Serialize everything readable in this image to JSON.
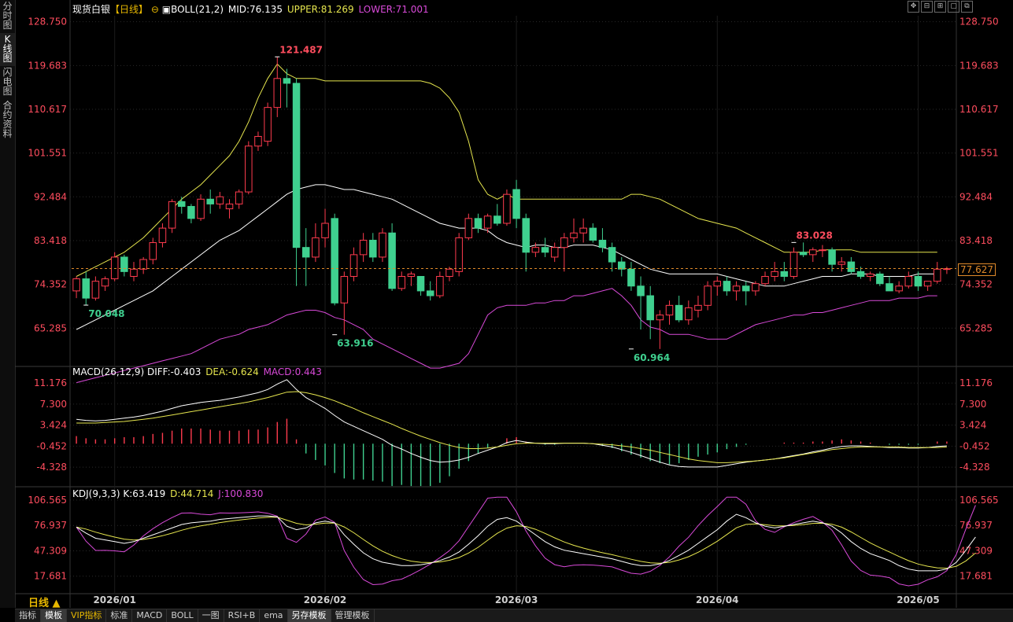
{
  "sidebar": {
    "items": [
      {
        "label": "分时图",
        "active": false
      },
      {
        "label": "K线图",
        "active": true
      },
      {
        "label": "闪电图",
        "active": false
      },
      {
        "label": "合约资料",
        "active": false
      }
    ]
  },
  "header": {
    "instrument": "现货白银",
    "period": "【日线】",
    "indicator": "BOLL(21,2)",
    "mid": "MID:76.135",
    "upper": "UPPER:81.269",
    "lower": "LOWER:71.001"
  },
  "macd_legend": {
    "name": "MACD(26,12,9)",
    "diff": "DIFF:-0.403",
    "dea": "DEA:-0.624",
    "macd": "MACD:0.443"
  },
  "kdj_legend": {
    "name": "KDJ(9,3,3)",
    "k": "K:63.419",
    "d": "D:44.714",
    "j": "J:100.830"
  },
  "toolbar_icons": [
    "move-cross-icon",
    "zoom-out-icon",
    "zoom-in-icon",
    "window-icon",
    "expand-icon"
  ],
  "current_price": "77.627",
  "period_selector": "日线 ▲",
  "bottom_tabs": [
    {
      "label": "指标",
      "active": false,
      "vip": false
    },
    {
      "label": "模板",
      "active": true,
      "vip": false
    },
    {
      "label": "VIP指标",
      "active": false,
      "vip": true
    },
    {
      "label": "标准",
      "active": false,
      "vip": false
    },
    {
      "label": "MACD",
      "active": false,
      "vip": false
    },
    {
      "label": "BOLL",
      "active": false,
      "vip": false
    },
    {
      "label": "一图",
      "active": false,
      "vip": false
    },
    {
      "label": "RSI+B",
      "active": false,
      "vip": false
    },
    {
      "label": "ema",
      "active": false,
      "vip": false
    },
    {
      "label": "另存模板",
      "active": true,
      "vip": false
    },
    {
      "label": "管理模板",
      "active": false,
      "vip": false
    }
  ],
  "colors": {
    "up": "#ff3b4e",
    "down": "#3fd08f",
    "upper": "#e6e64e",
    "mid": "#ffffff",
    "lower": "#d94ad9",
    "axis_label": "#ff4d5e",
    "grid": "#2a2a2a"
  },
  "chart_data": {
    "type": "candlestick",
    "price_axis": {
      "ticks": [
        "128.750",
        "119.683",
        "110.617",
        "101.551",
        "92.484",
        "83.418",
        "74.352",
        "65.285"
      ],
      "range": [
        58,
        130
      ]
    },
    "macd_axis": {
      "ticks": [
        "11.176",
        "7.300",
        "3.424",
        "-0.452",
        "-4.328"
      ],
      "range": [
        -7.5,
        12.5
      ]
    },
    "kdj_axis": {
      "ticks": [
        "106.565",
        "76.937",
        "47.309",
        "17.681"
      ],
      "range": [
        0,
        112
      ]
    },
    "x_labels": [
      {
        "text": "2026/01",
        "index": 4
      },
      {
        "text": "2026/02",
        "index": 26
      },
      {
        "text": "2026/03",
        "index": 46
      },
      {
        "text": "2026/04",
        "index": 67
      },
      {
        "text": "2026/05",
        "index": 88
      }
    ],
    "annotations": [
      {
        "text": "121.487",
        "index": 21,
        "value": 121.487,
        "kind": "high"
      },
      {
        "text": "70.048",
        "index": 1,
        "value": 70.048,
        "kind": "low"
      },
      {
        "text": "63.916",
        "index": 27,
        "value": 63.916,
        "kind": "low"
      },
      {
        "text": "60.964",
        "index": 58,
        "value": 60.964,
        "kind": "low"
      },
      {
        "text": "83.028",
        "index": 75,
        "value": 83.028,
        "kind": "high"
      }
    ],
    "ohlc": [
      [
        73,
        76,
        71.5,
        75.5
      ],
      [
        75.5,
        77,
        70,
        71.5
      ],
      [
        71.5,
        76,
        71,
        75
      ],
      [
        74,
        76,
        73,
        75.5
      ],
      [
        75.5,
        81,
        75,
        80
      ],
      [
        80,
        80.5,
        76,
        77
      ],
      [
        76,
        79,
        75,
        77.5
      ],
      [
        77.5,
        80,
        76.5,
        79.5
      ],
      [
        79.5,
        84,
        78.5,
        83
      ],
      [
        83,
        87,
        82,
        86
      ],
      [
        86,
        92,
        85,
        91.5
      ],
      [
        91.5,
        92.5,
        89,
        90.5
      ],
      [
        90.5,
        91,
        87,
        88
      ],
      [
        88,
        93,
        87.5,
        92
      ],
      [
        92,
        94,
        89,
        91
      ],
      [
        91,
        93.5,
        90,
        92.5
      ],
      [
        90,
        92,
        88,
        91
      ],
      [
        91,
        94,
        90,
        93.5
      ],
      [
        93.5,
        104,
        93,
        103
      ],
      [
        103,
        106,
        102,
        105
      ],
      [
        104,
        112,
        103,
        111
      ],
      [
        111,
        121.487,
        109,
        117
      ],
      [
        117,
        119,
        111,
        116
      ],
      [
        116,
        117,
        74,
        82
      ],
      [
        82,
        86,
        74,
        80
      ],
      [
        80,
        87,
        79,
        84
      ],
      [
        84,
        90,
        82,
        87
      ],
      [
        88,
        89,
        70,
        70.5
      ],
      [
        70.5,
        77,
        63.916,
        76
      ],
      [
        76,
        82,
        75,
        80.5
      ],
      [
        80.5,
        85,
        79,
        83.5
      ],
      [
        83.5,
        85,
        79,
        80
      ],
      [
        80,
        86,
        79,
        85
      ],
      [
        85,
        87,
        73,
        73.5
      ],
      [
        73.5,
        77,
        73,
        76
      ],
      [
        76,
        77,
        74,
        76.5
      ],
      [
        76,
        76,
        72,
        73
      ],
      [
        73,
        75,
        71,
        72
      ],
      [
        72,
        77,
        71.5,
        76
      ],
      [
        76,
        78,
        75,
        77.5
      ],
      [
        77,
        85,
        76,
        84
      ],
      [
        84,
        89,
        83.5,
        88
      ],
      [
        88,
        89,
        85,
        86
      ],
      [
        86,
        89,
        85,
        88.5
      ],
      [
        88.5,
        91,
        86.5,
        87
      ],
      [
        87,
        94,
        86.5,
        93
      ],
      [
        94,
        96,
        86,
        88
      ],
      [
        88,
        89,
        77,
        81
      ],
      [
        81,
        83,
        80,
        82
      ],
      [
        82,
        84,
        80,
        81
      ],
      [
        80,
        83,
        79,
        82
      ],
      [
        82,
        85,
        77,
        84
      ],
      [
        84,
        88,
        83,
        85
      ],
      [
        85,
        88,
        83,
        86
      ],
      [
        86,
        87,
        83,
        83.5
      ],
      [
        83.5,
        86,
        81,
        82
      ],
      [
        82,
        83,
        77,
        79
      ],
      [
        79,
        80,
        76,
        77.5
      ],
      [
        77.5,
        79,
        73,
        74
      ],
      [
        74,
        76,
        65,
        72
      ],
      [
        72,
        74,
        63,
        67
      ],
      [
        67,
        69,
        60.964,
        68
      ],
      [
        68,
        71,
        66,
        70
      ],
      [
        70,
        72,
        66.5,
        67
      ],
      [
        67,
        71,
        66,
        69.5
      ],
      [
        69,
        72,
        67.5,
        70
      ],
      [
        70,
        75,
        69,
        74
      ],
      [
        74,
        76,
        72,
        75
      ],
      [
        75,
        76,
        72,
        73
      ],
      [
        73,
        75,
        71,
        74
      ],
      [
        74,
        75,
        70,
        73
      ],
      [
        73,
        75,
        72,
        74.5
      ],
      [
        74.5,
        77,
        74,
        76
      ],
      [
        76,
        79,
        75,
        77
      ],
      [
        77,
        79,
        75,
        76
      ],
      [
        76,
        82,
        75.5,
        81
      ],
      [
        81,
        83.028,
        80,
        80.5
      ],
      [
        80.5,
        82,
        79,
        81.5
      ],
      [
        81.5,
        82.5,
        80,
        81.5
      ],
      [
        81.5,
        82,
        77,
        78.5
      ],
      [
        78.5,
        80,
        77,
        79
      ],
      [
        79,
        80,
        76.5,
        77
      ],
      [
        77,
        78,
        75.5,
        76
      ],
      [
        76,
        77,
        75,
        76.5
      ],
      [
        76.5,
        77,
        74,
        74.5
      ],
      [
        74.5,
        76,
        73,
        73
      ],
      [
        73,
        75,
        72.5,
        74
      ],
      [
        74,
        77,
        73.5,
        76
      ],
      [
        76,
        77,
        73,
        74
      ],
      [
        74,
        75,
        73,
        75
      ],
      [
        75,
        79,
        74.5,
        77.5
      ],
      [
        77.5,
        78,
        76.5,
        77.6
      ]
    ],
    "boll": {
      "mid": [
        65,
        66,
        67,
        68,
        69,
        70,
        71,
        72,
        73,
        74.5,
        76,
        77.5,
        79,
        80.5,
        82,
        83.5,
        84.5,
        85.5,
        87,
        88.5,
        90,
        91.5,
        93,
        94,
        94.5,
        95,
        95,
        94.5,
        94,
        94,
        93.5,
        93,
        92.5,
        92,
        91,
        90,
        89,
        88,
        87,
        86.5,
        86,
        86,
        86,
        85.5,
        84,
        83,
        82.5,
        82,
        82.5,
        82.5,
        82,
        82,
        82.5,
        82.5,
        82.5,
        82,
        81.5,
        80.5,
        79.5,
        78.5,
        77.5,
        77,
        76.5,
        76.5,
        76.5,
        76.5,
        76.5,
        76.5,
        76,
        75.5,
        75,
        74.5,
        74,
        74,
        74,
        74.5,
        75,
        75.5,
        76,
        76,
        76,
        76.5,
        76.5,
        76.5,
        76,
        76,
        76,
        76,
        76.5,
        76.5,
        76.5
      ],
      "upper": [
        76,
        77,
        78,
        79,
        80,
        81,
        82.5,
        84,
        86,
        88,
        90,
        92,
        93.5,
        95,
        97,
        99,
        101,
        104,
        108,
        113,
        117,
        120,
        118,
        117,
        117,
        117,
        116.5,
        116.5,
        116.5,
        116.5,
        116.5,
        116.5,
        116.5,
        116.5,
        116.5,
        116.5,
        116.5,
        116,
        115,
        113,
        110,
        104,
        96,
        93,
        92,
        93,
        92,
        92,
        92,
        92,
        92,
        92,
        92,
        92,
        92,
        92,
        92,
        92,
        93,
        93,
        92.5,
        92,
        91,
        90,
        89,
        88,
        87.5,
        87,
        86.5,
        86,
        85,
        84,
        83,
        82,
        81,
        81,
        81,
        81,
        81.5,
        81.5,
        81.5,
        81.5,
        81,
        81,
        81,
        81,
        81,
        81,
        81,
        81,
        81
      ],
      "lower": [
        54,
        54.5,
        55,
        55.5,
        56,
        56.5,
        57,
        57.5,
        58,
        58.5,
        59,
        59.5,
        60,
        61,
        62,
        63,
        63.5,
        64,
        65,
        65.5,
        66,
        67,
        68,
        68.5,
        69,
        69,
        68.5,
        67.5,
        67,
        66,
        65,
        63,
        62,
        61,
        60,
        59,
        58,
        57,
        57,
        57.5,
        58,
        60,
        64,
        68,
        69.5,
        70,
        70,
        70,
        70.5,
        70.5,
        71,
        71,
        72,
        72,
        72.5,
        73,
        73.5,
        72,
        70,
        67,
        65.5,
        65,
        64,
        64,
        64,
        63.5,
        63,
        63,
        63,
        64,
        65,
        66,
        66.5,
        67,
        67.5,
        68,
        68,
        68.5,
        68.5,
        69,
        69.5,
        70,
        70.5,
        71,
        71,
        71,
        71.5,
        71.5,
        71.5,
        72,
        72
      ]
    },
    "macd": {
      "diff": [
        4.5,
        4.3,
        4.2,
        4.3,
        4.5,
        4.7,
        4.9,
        5.2,
        5.6,
        6,
        6.5,
        7,
        7.3,
        7.6,
        7.8,
        8,
        8.3,
        8.6,
        9,
        9.4,
        10,
        11,
        11.8,
        10,
        8.5,
        7.5,
        6.5,
        5.2,
        4,
        3.2,
        2.4,
        1.6,
        0.8,
        -0.3,
        -1,
        -1.8,
        -2.5,
        -3.1,
        -3.4,
        -3.3,
        -3,
        -2.5,
        -1.8,
        -1.2,
        -0.6,
        0.2,
        0.6,
        0.3,
        0.1,
        0,
        0,
        0.1,
        0.1,
        0.1,
        0,
        -0.3,
        -0.6,
        -1.1,
        -1.6,
        -2.2,
        -2.8,
        -3.4,
        -3.9,
        -4.2,
        -4.3,
        -4.3,
        -4.3,
        -4.3,
        -4,
        -3.7,
        -3.4,
        -3.2,
        -3,
        -2.8,
        -2.5,
        -2.2,
        -1.9,
        -1.5,
        -1.2,
        -0.8,
        -0.5,
        -0.4,
        -0.4,
        -0.5,
        -0.6,
        -0.7,
        -0.7,
        -0.8,
        -0.8,
        -0.7,
        -0.5,
        -0.4
      ],
      "dea": [
        3.8,
        3.8,
        3.8,
        3.9,
        4,
        4.1,
        4.3,
        4.5,
        4.7,
        5,
        5.3,
        5.6,
        5.9,
        6.2,
        6.5,
        6.8,
        7.1,
        7.4,
        7.7,
        8.1,
        8.5,
        9,
        9.5,
        9.6,
        9.4,
        9,
        8.5,
        7.9,
        7.2,
        6.5,
        5.7,
        5,
        4.3,
        3.6,
        2.8,
        2.1,
        1.4,
        0.8,
        0.2,
        -0.3,
        -0.7,
        -0.9,
        -0.9,
        -0.8,
        -0.6,
        -0.3,
        0,
        0.1,
        0.1,
        0.1,
        0.1,
        0.1,
        0.1,
        0.1,
        0,
        -0.1,
        -0.2,
        -0.4,
        -0.6,
        -0.9,
        -1.2,
        -1.6,
        -2,
        -2.4,
        -2.8,
        -3.1,
        -3.3,
        -3.5,
        -3.5,
        -3.4,
        -3.3,
        -3.2,
        -3,
        -2.8,
        -2.6,
        -2.3,
        -2,
        -1.7,
        -1.4,
        -1.1,
        -0.9,
        -0.7,
        -0.6,
        -0.6,
        -0.6,
        -0.6,
        -0.6,
        -0.7,
        -0.7,
        -0.7,
        -0.7,
        -0.6
      ]
    },
    "kdj": {
      "k": [
        75,
        68,
        62,
        60,
        58,
        56,
        58,
        62,
        66,
        70,
        74,
        78,
        80,
        81,
        82,
        84,
        85,
        86,
        87,
        88,
        88,
        87,
        76,
        72,
        74,
        80,
        82,
        80,
        66,
        55,
        45,
        38,
        34,
        32,
        30,
        30,
        31,
        33,
        36,
        40,
        46,
        55,
        65,
        76,
        84,
        86,
        82,
        74,
        66,
        58,
        52,
        48,
        46,
        44,
        42,
        40,
        38,
        35,
        32,
        30,
        30,
        32,
        36,
        42,
        48,
        56,
        64,
        72,
        82,
        90,
        86,
        80,
        76,
        74,
        76,
        78,
        80,
        82,
        80,
        76,
        68,
        58,
        50,
        44,
        40,
        36,
        30,
        26,
        24,
        24,
        24,
        26,
        34,
        48,
        63.4
      ]
    }
  }
}
